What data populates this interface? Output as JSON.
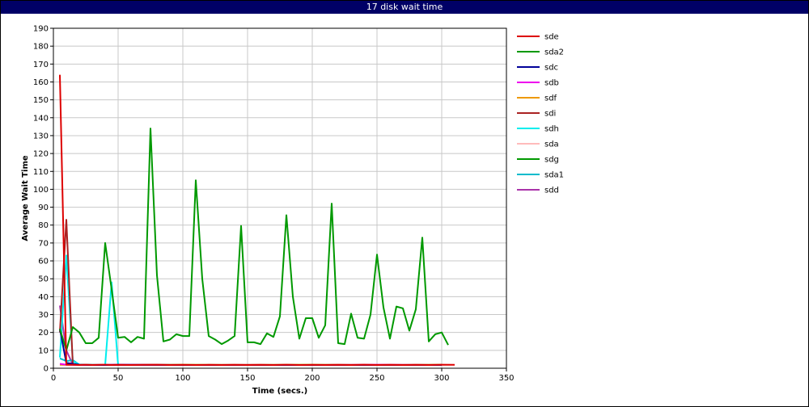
{
  "window": {
    "title": "17 disk wait time"
  },
  "chart_data": {
    "type": "line",
    "title": "17 disk wait time",
    "xlabel": "Time (secs.)",
    "ylabel": "Average Wait Time",
    "xlim": [
      0,
      350
    ],
    "ylim": [
      0,
      190
    ],
    "xticks": [
      0,
      50,
      100,
      150,
      200,
      250,
      300,
      350
    ],
    "yticks": [
      0,
      10,
      20,
      30,
      40,
      50,
      60,
      70,
      80,
      90,
      100,
      110,
      120,
      130,
      140,
      150,
      160,
      170,
      180,
      190
    ],
    "grid": true,
    "legend_position": "right",
    "series": [
      {
        "name": "sde",
        "color": "#dd0000",
        "points": [
          [
            5,
            164
          ],
          [
            10,
            2
          ],
          [
            15,
            2
          ],
          [
            20,
            1.8
          ],
          [
            25,
            2
          ],
          [
            30,
            1.8
          ],
          [
            35,
            1.9
          ],
          [
            40,
            2
          ],
          [
            45,
            1.8
          ],
          [
            50,
            1.9
          ],
          [
            60,
            1.8
          ],
          [
            70,
            1.9
          ],
          [
            80,
            2
          ],
          [
            90,
            1.8
          ],
          [
            100,
            1.9
          ],
          [
            110,
            1.8
          ],
          [
            120,
            1.9
          ],
          [
            130,
            1.8
          ],
          [
            140,
            1.9
          ],
          [
            150,
            1.8
          ],
          [
            160,
            1.9
          ],
          [
            170,
            1.8
          ],
          [
            180,
            2
          ],
          [
            190,
            1.8
          ],
          [
            200,
            1.9
          ],
          [
            210,
            1.8
          ],
          [
            220,
            1.9
          ],
          [
            230,
            1.8
          ],
          [
            240,
            2
          ],
          [
            250,
            1.8
          ],
          [
            260,
            1.9
          ],
          [
            270,
            1.8
          ],
          [
            280,
            1.9
          ],
          [
            290,
            1.8
          ],
          [
            300,
            2
          ],
          [
            310,
            1.9
          ]
        ]
      },
      {
        "name": "sda2",
        "color": "#009900",
        "points": [
          [
            5,
            22
          ],
          [
            10,
            10
          ],
          [
            15,
            23
          ],
          [
            20,
            20
          ],
          [
            25,
            14
          ],
          [
            30,
            14
          ],
          [
            35,
            17
          ],
          [
            40,
            70
          ],
          [
            45,
            44
          ],
          [
            50,
            17
          ],
          [
            55,
            17.5
          ],
          [
            60,
            14.5
          ],
          [
            65,
            17.5
          ],
          [
            70,
            16.5
          ],
          [
            75,
            134
          ],
          [
            80,
            52
          ],
          [
            85,
            15
          ],
          [
            90,
            16
          ],
          [
            95,
            19
          ],
          [
            100,
            18
          ],
          [
            105,
            18
          ],
          [
            110,
            105
          ],
          [
            115,
            50
          ],
          [
            120,
            18
          ],
          [
            125,
            16
          ],
          [
            130,
            13.5
          ],
          [
            135,
            15.5
          ],
          [
            140,
            18
          ],
          [
            145,
            79.5
          ],
          [
            150,
            14.5
          ],
          [
            155,
            14.5
          ],
          [
            160,
            13.5
          ],
          [
            165,
            19.5
          ],
          [
            170,
            17.5
          ],
          [
            175,
            29
          ],
          [
            180,
            85.5
          ],
          [
            185,
            40
          ],
          [
            190,
            16.5
          ],
          [
            195,
            28
          ],
          [
            200,
            28
          ],
          [
            205,
            17
          ],
          [
            210,
            24
          ],
          [
            215,
            92
          ],
          [
            220,
            14
          ],
          [
            225,
            13.5
          ],
          [
            230,
            30.5
          ],
          [
            235,
            17
          ],
          [
            240,
            16.5
          ],
          [
            245,
            30
          ],
          [
            250,
            63.5
          ],
          [
            255,
            34
          ],
          [
            260,
            16.5
          ],
          [
            265,
            34.5
          ],
          [
            270,
            33.5
          ],
          [
            275,
            21
          ],
          [
            280,
            33
          ],
          [
            285,
            73
          ],
          [
            290,
            15
          ],
          [
            295,
            19
          ],
          [
            300,
            20
          ],
          [
            305,
            13
          ]
        ]
      },
      {
        "name": "sdc",
        "color": "#000099",
        "points": [
          [
            5,
            22
          ],
          [
            10,
            3
          ],
          [
            15,
            2.5
          ],
          [
            20,
            2
          ],
          [
            30,
            1.8
          ],
          [
            40,
            1.8
          ],
          [
            50,
            1.9
          ],
          [
            100,
            1.8
          ],
          [
            150,
            1.8
          ],
          [
            200,
            1.8
          ],
          [
            250,
            1.8
          ],
          [
            300,
            1.8
          ]
        ]
      },
      {
        "name": "sdb",
        "color": "#ee00ee",
        "points": [
          [
            5,
            2.5
          ],
          [
            10,
            2
          ],
          [
            20,
            1.8
          ],
          [
            50,
            1.9
          ],
          [
            100,
            1.8
          ],
          [
            150,
            1.8
          ],
          [
            200,
            1.8
          ],
          [
            250,
            1.9
          ],
          [
            300,
            1.8
          ]
        ]
      },
      {
        "name": "sdf",
        "color": "#ee9900",
        "points": [
          [
            5,
            2
          ],
          [
            10,
            1.9
          ],
          [
            50,
            1.8
          ],
          [
            100,
            1.9
          ],
          [
            150,
            1.8
          ],
          [
            200,
            1.9
          ],
          [
            250,
            1.8
          ],
          [
            300,
            1.9
          ]
        ]
      },
      {
        "name": "sdi",
        "color": "#aa2222",
        "points": [
          [
            5,
            20
          ],
          [
            10,
            83
          ],
          [
            15,
            2
          ],
          [
            20,
            1.8
          ],
          [
            50,
            1.9
          ],
          [
            100,
            1.8
          ],
          [
            150,
            1.9
          ],
          [
            200,
            1.8
          ],
          [
            250,
            1.9
          ],
          [
            300,
            1.8
          ]
        ]
      },
      {
        "name": "sdh",
        "color": "#00eeee",
        "points": [
          [
            5,
            6
          ],
          [
            10,
            63
          ],
          [
            15,
            4
          ],
          [
            20,
            2
          ],
          [
            40,
            1.8
          ],
          [
            45,
            48
          ],
          [
            50,
            1.8
          ],
          [
            100,
            1.8
          ],
          [
            150,
            1.8
          ],
          [
            200,
            1.8
          ],
          [
            250,
            1.8
          ],
          [
            300,
            1.8
          ]
        ]
      },
      {
        "name": "sda",
        "color": "#ffbbbb",
        "points": [
          [
            5,
            2
          ],
          [
            10,
            1.8
          ],
          [
            50,
            1.8
          ],
          [
            100,
            1.8
          ],
          [
            150,
            1.8
          ],
          [
            200,
            1.8
          ],
          [
            250,
            1.8
          ],
          [
            300,
            1.8
          ]
        ]
      },
      {
        "name": "sdg",
        "color": "#009900",
        "points": [
          [
            5,
            2
          ],
          [
            10,
            1.9
          ],
          [
            50,
            1.8
          ],
          [
            100,
            1.9
          ],
          [
            150,
            1.8
          ],
          [
            200,
            1.9
          ],
          [
            250,
            1.8
          ],
          [
            300,
            1.9
          ]
        ]
      },
      {
        "name": "sda1",
        "color": "#00bbcc",
        "points": [
          [
            5,
            5.5
          ],
          [
            10,
            4
          ],
          [
            15,
            4.5
          ],
          [
            20,
            2
          ],
          [
            50,
            1.8
          ],
          [
            100,
            1.8
          ],
          [
            150,
            1.8
          ],
          [
            200,
            1.8
          ],
          [
            250,
            1.8
          ],
          [
            300,
            1.8
          ]
        ]
      },
      {
        "name": "sdd",
        "color": "#aa33aa",
        "points": [
          [
            5,
            35
          ],
          [
            10,
            10
          ],
          [
            15,
            2
          ],
          [
            20,
            1.8
          ],
          [
            50,
            1.8
          ],
          [
            100,
            1.8
          ],
          [
            150,
            1.8
          ],
          [
            200,
            1.8
          ],
          [
            250,
            1.8
          ],
          [
            300,
            1.8
          ]
        ]
      }
    ]
  }
}
